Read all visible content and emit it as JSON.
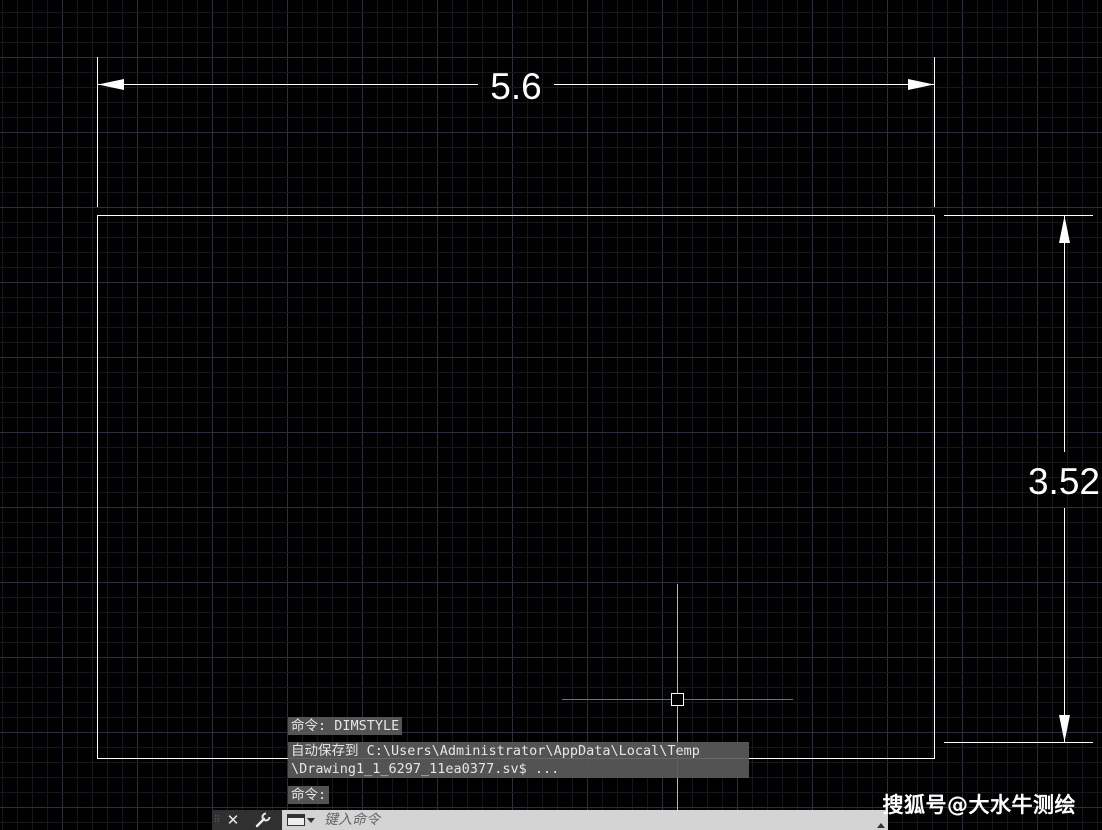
{
  "drawing": {
    "horizontal_dimension": "5.6",
    "vertical_dimension": "3.52"
  },
  "command_history": [
    "命令: DIMSTYLE",
    "自动保存到 C:\\Users\\Administrator\\AppData\\Local\\Temp",
    "\\Drawing1_1_6297_11ea0377.sv$ ...",
    "命令:"
  ],
  "command_line": {
    "placeholder": "键入命令"
  },
  "watermark": "搜狐号@大水牛测绘",
  "colors": {
    "background": "#000000",
    "grid_major": "#2a2f3a",
    "grid_minor": "#15171d",
    "geometry": "#ffffff",
    "crosshair_x": "#c0504d",
    "crosshair_y": "#b6c36a"
  },
  "icons": [
    "grip-icon",
    "close-icon",
    "wrench-icon",
    "command-prompt-icon",
    "chevron-down-icon",
    "chevron-up-icon",
    "pickbox-icon"
  ]
}
